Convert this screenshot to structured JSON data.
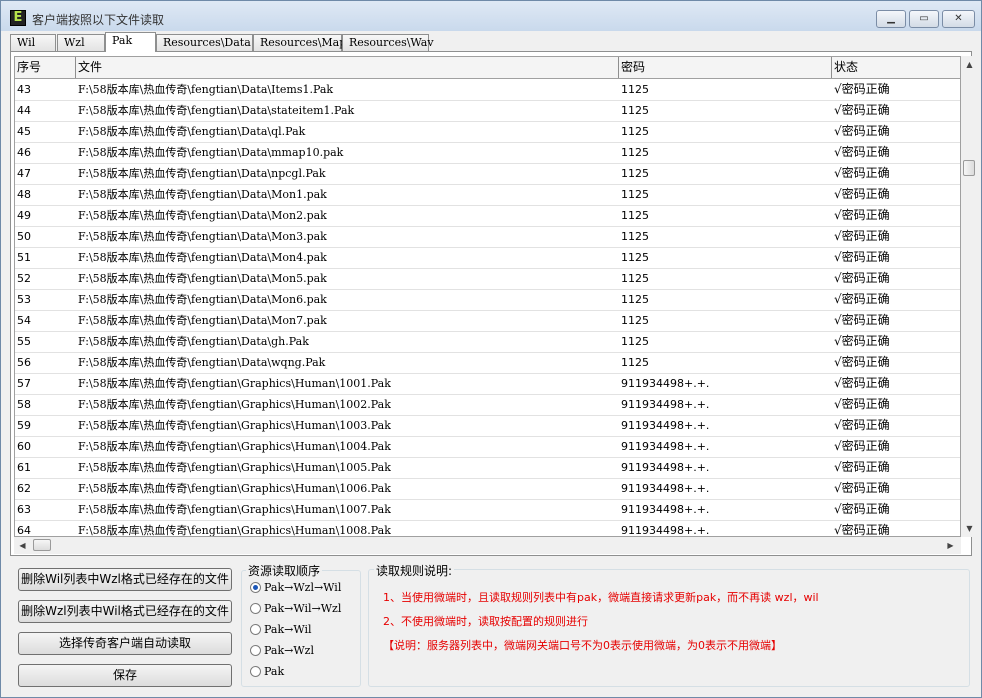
{
  "window": {
    "title": "客户端按照以下文件读取",
    "icon_letter": "E"
  },
  "tabs": [
    "Wil",
    "Wzl",
    "Pak",
    "Resources\\Data",
    "Resources\\Map",
    "Resources\\Wav"
  ],
  "active_tab": "Pak",
  "table": {
    "headers": [
      "序号",
      "文件",
      "密码",
      "状态"
    ],
    "rows": [
      {
        "idx": "43",
        "file": "F:\\58版本库\\热血传奇\\fengtian\\Data\\Items1.Pak",
        "pwd": "1125",
        "status": "√密码正确"
      },
      {
        "idx": "44",
        "file": "F:\\58版本库\\热血传奇\\fengtian\\Data\\stateitem1.Pak",
        "pwd": "1125",
        "status": "√密码正确"
      },
      {
        "idx": "45",
        "file": "F:\\58版本库\\热血传奇\\fengtian\\Data\\ql.Pak",
        "pwd": "1125",
        "status": "√密码正确"
      },
      {
        "idx": "46",
        "file": "F:\\58版本库\\热血传奇\\fengtian\\Data\\mmap10.pak",
        "pwd": "1125",
        "status": "√密码正确"
      },
      {
        "idx": "47",
        "file": "F:\\58版本库\\热血传奇\\fengtian\\Data\\npcgl.Pak",
        "pwd": "1125",
        "status": "√密码正确"
      },
      {
        "idx": "48",
        "file": "F:\\58版本库\\热血传奇\\fengtian\\Data\\Mon1.pak",
        "pwd": "1125",
        "status": "√密码正确"
      },
      {
        "idx": "49",
        "file": "F:\\58版本库\\热血传奇\\fengtian\\Data\\Mon2.pak",
        "pwd": "1125",
        "status": "√密码正确"
      },
      {
        "idx": "50",
        "file": "F:\\58版本库\\热血传奇\\fengtian\\Data\\Mon3.pak",
        "pwd": "1125",
        "status": "√密码正确"
      },
      {
        "idx": "51",
        "file": "F:\\58版本库\\热血传奇\\fengtian\\Data\\Mon4.pak",
        "pwd": "1125",
        "status": "√密码正确"
      },
      {
        "idx": "52",
        "file": "F:\\58版本库\\热血传奇\\fengtian\\Data\\Mon5.pak",
        "pwd": "1125",
        "status": "√密码正确"
      },
      {
        "idx": "53",
        "file": "F:\\58版本库\\热血传奇\\fengtian\\Data\\Mon6.pak",
        "pwd": "1125",
        "status": "√密码正确"
      },
      {
        "idx": "54",
        "file": "F:\\58版本库\\热血传奇\\fengtian\\Data\\Mon7.pak",
        "pwd": "1125",
        "status": "√密码正确"
      },
      {
        "idx": "55",
        "file": "F:\\58版本库\\热血传奇\\fengtian\\Data\\gh.Pak",
        "pwd": "1125",
        "status": "√密码正确"
      },
      {
        "idx": "56",
        "file": "F:\\58版本库\\热血传奇\\fengtian\\Data\\wqng.Pak",
        "pwd": "1125",
        "status": "√密码正确"
      },
      {
        "idx": "57",
        "file": "F:\\58版本库\\热血传奇\\fengtian\\Graphics\\Human\\1001.Pak",
        "pwd": "911934498+.+.",
        "status": "√密码正确"
      },
      {
        "idx": "58",
        "file": "F:\\58版本库\\热血传奇\\fengtian\\Graphics\\Human\\1002.Pak",
        "pwd": "911934498+.+.",
        "status": "√密码正确"
      },
      {
        "idx": "59",
        "file": "F:\\58版本库\\热血传奇\\fengtian\\Graphics\\Human\\1003.Pak",
        "pwd": "911934498+.+.",
        "status": "√密码正确"
      },
      {
        "idx": "60",
        "file": "F:\\58版本库\\热血传奇\\fengtian\\Graphics\\Human\\1004.Pak",
        "pwd": "911934498+.+.",
        "status": "√密码正确"
      },
      {
        "idx": "61",
        "file": "F:\\58版本库\\热血传奇\\fengtian\\Graphics\\Human\\1005.Pak",
        "pwd": "911934498+.+.",
        "status": "√密码正确"
      },
      {
        "idx": "62",
        "file": "F:\\58版本库\\热血传奇\\fengtian\\Graphics\\Human\\1006.Pak",
        "pwd": "911934498+.+.",
        "status": "√密码正确"
      },
      {
        "idx": "63",
        "file": "F:\\58版本库\\热血传奇\\fengtian\\Graphics\\Human\\1007.Pak",
        "pwd": "911934498+.+.",
        "status": "√密码正确"
      },
      {
        "idx": "64",
        "file": "F:\\58版本库\\热血传奇\\fengtian\\Graphics\\Human\\1008.Pak",
        "pwd": "911934498+.+.",
        "status": "√密码正确"
      }
    ]
  },
  "buttons": {
    "delete_wil": "删除Wil列表中Wzl格式已经存在的文件",
    "delete_wzl": "删除Wzl列表中Wil格式已经存在的文件",
    "select_client": "选择传奇客户端自动读取",
    "save": "保存"
  },
  "read_order": {
    "title": "资源读取顺序",
    "options": [
      "Pak→Wzl→Wil",
      "Pak→Wil→Wzl",
      "Pak→Wil",
      "Pak→Wzl",
      "Pak"
    ],
    "selected": "Pak→Wzl→Wil"
  },
  "rules": {
    "title": "读取规则说明:",
    "line1": "1、当使用微端时，且读取规则列表中有pak，微端直接请求更新pak，而不再读 wzl，wil",
    "line2": "2、不使用微端时，读取按配置的规则进行",
    "line3": "【说明：服务器列表中，微端网关端口号不为0表示使用微端，为0表示不用微端】"
  },
  "colors": {
    "rule_text": "#e60000",
    "title_gradient_top": "#dfe9f5",
    "radio_selected": "#1c57b8"
  }
}
